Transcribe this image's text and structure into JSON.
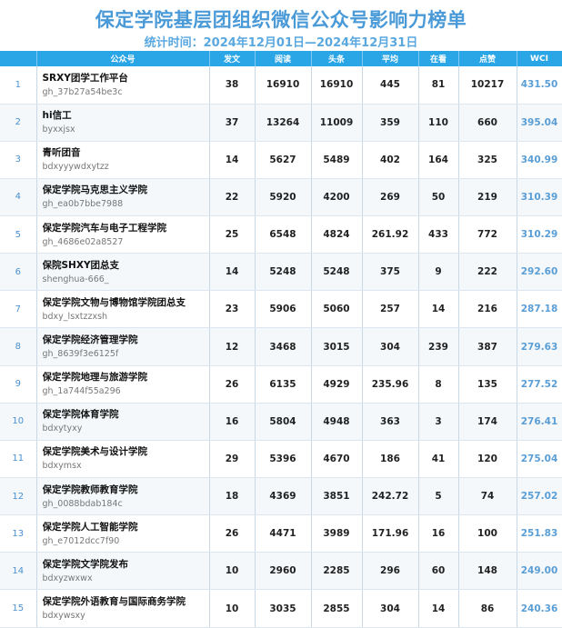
{
  "title": "保定学院基层团组织微信公众号影响力榜单",
  "subtitle": "统计时间：2024年12月01日—2024年12月31日",
  "columns": [
    "公众号",
    "发文",
    "阅读",
    "头条",
    "平均",
    "在看",
    "点赞",
    "WCI"
  ],
  "rows": [
    {
      "rank": "1",
      "name": "SRXY团学工作平台",
      "id": "gh_37b27a54be3c",
      "posts": "38",
      "reads": "16910",
      "headline": "16910",
      "avg": "445",
      "watching": "81",
      "likes": "10217",
      "wci": "431.50"
    },
    {
      "rank": "2",
      "name": "hi信工",
      "id": "byxxjsx",
      "posts": "37",
      "reads": "13264",
      "headline": "11009",
      "avg": "359",
      "watching": "110",
      "likes": "660",
      "wci": "395.04"
    },
    {
      "rank": "3",
      "name": "青听团音",
      "id": "bdxyyywdxytzz",
      "posts": "14",
      "reads": "5627",
      "headline": "5489",
      "avg": "402",
      "watching": "164",
      "likes": "325",
      "wci": "340.99"
    },
    {
      "rank": "4",
      "name": "保定学院马克思主义学院",
      "id": "gh_ea0b7bbe7988",
      "posts": "22",
      "reads": "5920",
      "headline": "4200",
      "avg": "269",
      "watching": "50",
      "likes": "219",
      "wci": "310.39"
    },
    {
      "rank": "5",
      "name": "保定学院汽车与电子工程学院",
      "id": "gh_4686e02a8527",
      "posts": "25",
      "reads": "6548",
      "headline": "4824",
      "avg": "261.92",
      "watching": "433",
      "likes": "772",
      "wci": "310.29"
    },
    {
      "rank": "6",
      "name": "保院SHXY团总支",
      "id": "shenghua-666_",
      "posts": "14",
      "reads": "5248",
      "headline": "5248",
      "avg": "375",
      "watching": "9",
      "likes": "222",
      "wci": "292.60"
    },
    {
      "rank": "7",
      "name": "保定学院文物与博物馆学院团总支",
      "id": "bdxy_lsxtzzxsh",
      "posts": "23",
      "reads": "5906",
      "headline": "5060",
      "avg": "257",
      "watching": "14",
      "likes": "216",
      "wci": "287.18"
    },
    {
      "rank": "8",
      "name": "保定学院经济管理学院",
      "id": "gh_8639f3e6125f",
      "posts": "12",
      "reads": "3468",
      "headline": "3015",
      "avg": "304",
      "watching": "239",
      "likes": "387",
      "wci": "279.63"
    },
    {
      "rank": "9",
      "name": "保定学院地理与旅游学院",
      "id": "gh_1a744f55a296",
      "posts": "26",
      "reads": "6135",
      "headline": "4929",
      "avg": "235.96",
      "watching": "8",
      "likes": "135",
      "wci": "277.52"
    },
    {
      "rank": "10",
      "name": "保定学院体育学院",
      "id": "bdxytyxy",
      "posts": "16",
      "reads": "5804",
      "headline": "4948",
      "avg": "363",
      "watching": "3",
      "likes": "174",
      "wci": "276.41"
    },
    {
      "rank": "11",
      "name": "保定学院美术与设计学院",
      "id": "bdxymsx",
      "posts": "29",
      "reads": "5396",
      "headline": "4670",
      "avg": "186",
      "watching": "41",
      "likes": "120",
      "wci": "275.04"
    },
    {
      "rank": "12",
      "name": "保定学院教师教育学院",
      "id": "gh_0088bdab184c",
      "posts": "18",
      "reads": "4369",
      "headline": "3851",
      "avg": "242.72",
      "watching": "5",
      "likes": "74",
      "wci": "257.02"
    },
    {
      "rank": "13",
      "name": "保定学院人工智能学院",
      "id": "gh_e7012dcc7f90",
      "posts": "26",
      "reads": "4471",
      "headline": "3989",
      "avg": "171.96",
      "watching": "16",
      "likes": "100",
      "wci": "251.83"
    },
    {
      "rank": "14",
      "name": "保定学院文学院发布",
      "id": "bdxyzwxwx",
      "posts": "10",
      "reads": "2960",
      "headline": "2285",
      "avg": "296",
      "watching": "60",
      "likes": "148",
      "wci": "249.00"
    },
    {
      "rank": "15",
      "name": "保定学院外语教育与国际商务学院",
      "id": "bdxywsxy",
      "posts": "10",
      "reads": "3035",
      "headline": "2855",
      "avg": "304",
      "watching": "14",
      "likes": "86",
      "wci": "240.36"
    }
  ]
}
